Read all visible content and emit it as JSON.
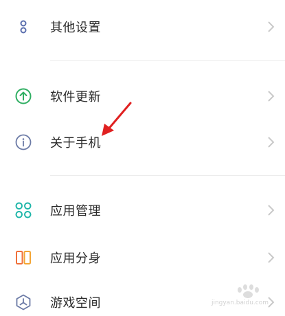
{
  "settings": {
    "items": [
      {
        "label": "其他设置",
        "icon": "dots-vertical-icon"
      },
      {
        "label": "软件更新",
        "icon": "upgrade-arrow-icon"
      },
      {
        "label": "关于手机",
        "icon": "info-icon"
      },
      {
        "label": "应用管理",
        "icon": "app-grid-icon"
      },
      {
        "label": "应用分身",
        "icon": "app-clone-icon"
      },
      {
        "label": "游戏空间",
        "icon": "game-space-icon"
      }
    ],
    "colors": {
      "other": "#5b6fae",
      "update": "#2fae62",
      "info": "#6b7aa6",
      "apps": "#1cb5a8",
      "clone_left": "#f0703a",
      "clone_right": "#f3a533",
      "game": "#6b7aa6",
      "annotation_arrow": "#e02020"
    }
  },
  "watermark": {
    "text": "jingyan.baidu.com"
  }
}
